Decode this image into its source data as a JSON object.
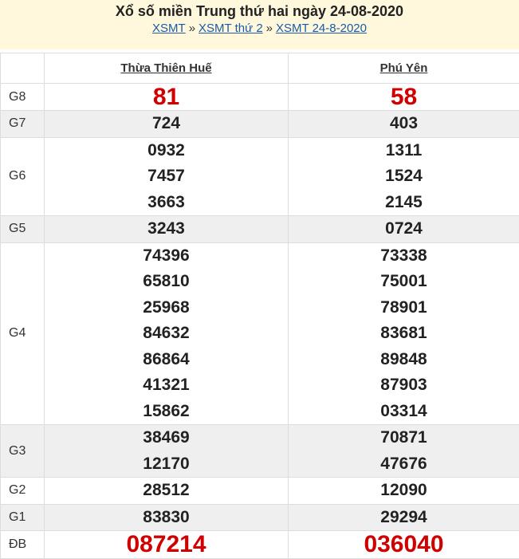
{
  "header": {
    "title": "Xổ số miền Trung thứ hai ngày 24-08-2020",
    "breadcrumbs": [
      "XSMT",
      "XSMT thứ 2",
      "XSMT 24-8-2020"
    ],
    "separator": "»",
    "background_color": "#fff8dc",
    "link_color": "#1a5aa8"
  },
  "table": {
    "provinces": [
      "Thừa Thiên Huế",
      "Phú Yên"
    ],
    "rows": [
      {
        "prize": "G8",
        "a": [
          "81"
        ],
        "b": [
          "58"
        ]
      },
      {
        "prize": "G7",
        "a": [
          "724"
        ],
        "b": [
          "403"
        ]
      },
      {
        "prize": "G6",
        "a": [
          "0932",
          "7457",
          "3663"
        ],
        "b": [
          "1311",
          "1524",
          "2145"
        ]
      },
      {
        "prize": "G5",
        "a": [
          "3243"
        ],
        "b": [
          "0724"
        ]
      },
      {
        "prize": "G4",
        "a": [
          "74396",
          "65810",
          "25968",
          "84632",
          "86864",
          "41321",
          "15862"
        ],
        "b": [
          "73338",
          "75001",
          "78901",
          "83681",
          "89848",
          "87903",
          "03314"
        ]
      },
      {
        "prize": "G3",
        "a": [
          "38469",
          "12170"
        ],
        "b": [
          "70871",
          "47676"
        ]
      },
      {
        "prize": "G2",
        "a": [
          "28512"
        ],
        "b": [
          "12090"
        ]
      },
      {
        "prize": "G1",
        "a": [
          "83830"
        ],
        "b": [
          "29294"
        ]
      },
      {
        "prize": "ĐB",
        "a": [
          "087214"
        ],
        "b": [
          "036040"
        ]
      }
    ],
    "highlight_color": "#d10000",
    "alt_row_color": "#efefef"
  }
}
